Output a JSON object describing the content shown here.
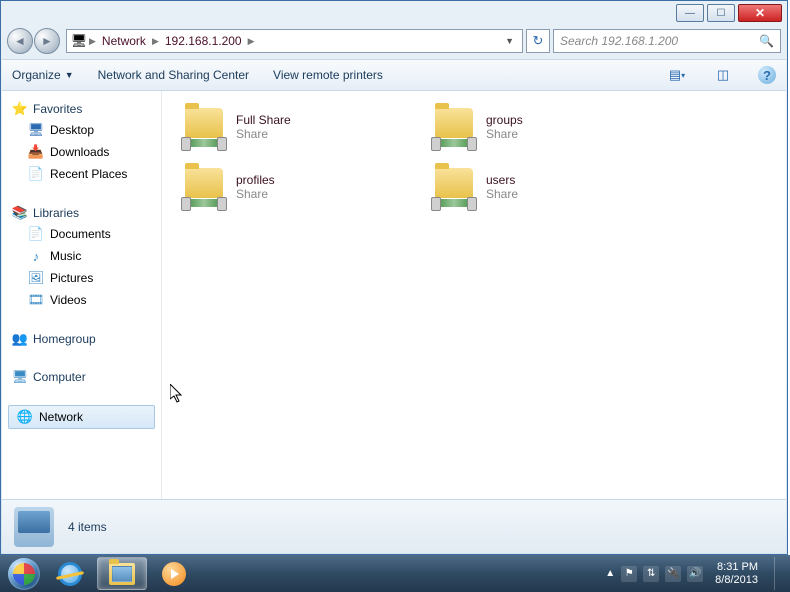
{
  "breadcrumb": {
    "root": "Network",
    "host": "192.168.1.200"
  },
  "search": {
    "placeholder": "Search 192.168.1.200"
  },
  "toolbar": {
    "organize": "Organize",
    "nsc": "Network and Sharing Center",
    "vrp": "View remote printers"
  },
  "nav": {
    "favorites": {
      "label": "Favorites",
      "desktop": "Desktop",
      "downloads": "Downloads",
      "recent": "Recent Places"
    },
    "libraries": {
      "label": "Libraries",
      "documents": "Documents",
      "music": "Music",
      "pictures": "Pictures",
      "videos": "Videos"
    },
    "homegroup": "Homegroup",
    "computer": "Computer",
    "network": "Network"
  },
  "shares": [
    {
      "name": "Full Share",
      "type": "Share"
    },
    {
      "name": "groups",
      "type": "Share"
    },
    {
      "name": "profiles",
      "type": "Share"
    },
    {
      "name": "users",
      "type": "Share"
    }
  ],
  "status": {
    "count": "4 items"
  },
  "tray": {
    "time": "8:31 PM",
    "date": "8/8/2013"
  }
}
